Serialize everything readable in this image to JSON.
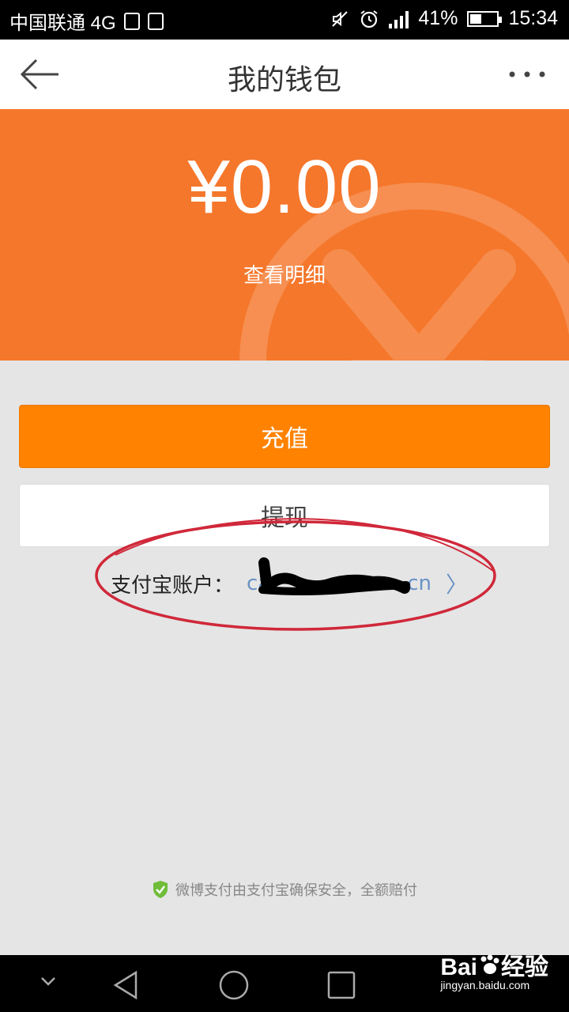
{
  "status_bar": {
    "carrier": "中国联通 4G",
    "network_badge": "4G",
    "battery": "41%",
    "battery_level": 0.41,
    "time": "15:34"
  },
  "nav": {
    "title": "我的钱包"
  },
  "balance": {
    "amount": "¥0.00",
    "detail_link": "查看明细"
  },
  "actions": {
    "charge_label": "充值",
    "withdraw_label": "提现"
  },
  "account": {
    "label": "支付宝账户：",
    "value_start": "ca",
    "value_end": "cn",
    "chevron": "〉"
  },
  "footer": {
    "note": "微博支付由支付宝确保安全，全额赔付"
  },
  "watermark": {
    "brand": "Bai",
    "brand2": "经验",
    "url": "jingyan.baidu.com"
  },
  "colors": {
    "balance_bg": "#f5772b",
    "charge_button": "#ff8200",
    "link_blue": "#6a93c6",
    "annotation_red": "#d0283a"
  }
}
